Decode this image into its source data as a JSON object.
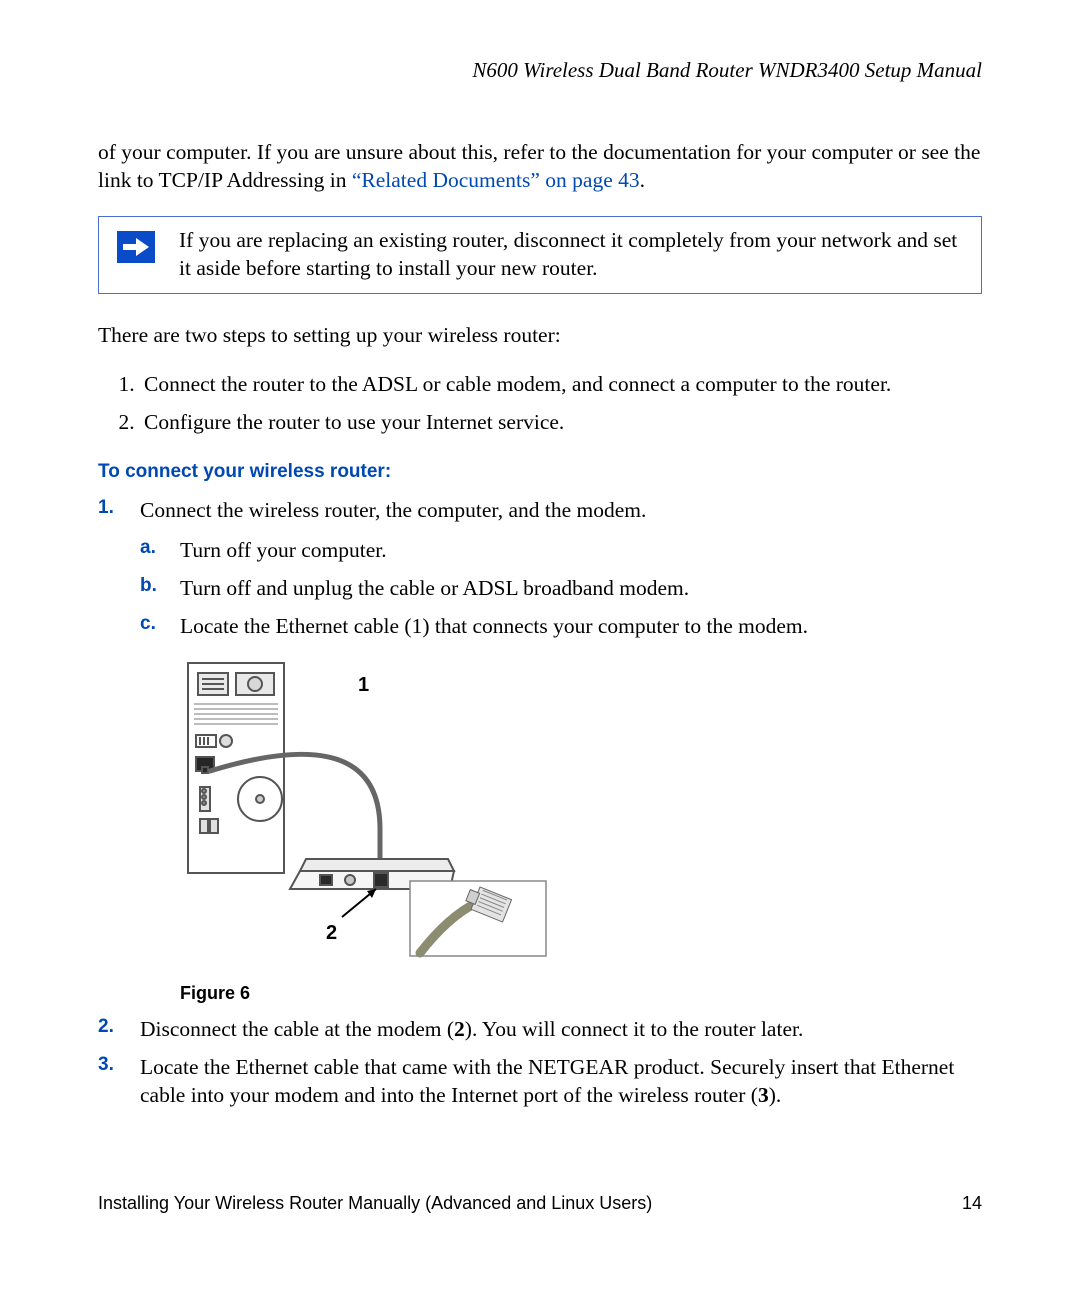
{
  "header": "N600 Wireless Dual Band Router WNDR3400 Setup Manual",
  "intro": {
    "pre_link": "of your computer. If you are unsure about this, refer to the documentation for your computer or see the link to TCP/IP Addressing in ",
    "link": "“Related Documents” on page 43",
    "post_link": "."
  },
  "note": "If you are replacing an existing router, disconnect it completely from your network and set it aside before starting to install your new router.",
  "steps_intro": "There are two steps to setting up your wireless router:",
  "simple_steps": [
    "Connect the router to the ADSL or cable modem, and connect a computer to the router.",
    "Configure the router to use your Internet service."
  ],
  "section_heading": "To connect your wireless router:",
  "blue_steps": {
    "s1": "Connect the wireless router, the computer, and the modem.",
    "s1a": "Turn off your computer.",
    "s1b": "Turn off and unplug the cable or ADSL broadband modem.",
    "s1c": "Locate the Ethernet cable (1) that connects your computer to the modem.",
    "s2_pre": "Disconnect the cable at the modem (",
    "s2_bold": "2",
    "s2_post": "). You will connect it to the router later.",
    "s3_pre": "Locate the Ethernet cable that came with the NETGEAR product. Securely insert that Ethernet cable into your modem and into the Internet port of the wireless router (",
    "s3_bold": "3",
    "s3_post": ")."
  },
  "figure": {
    "caption": "Figure 6",
    "label1": "1",
    "label2": "2"
  },
  "footer": {
    "left": "Installing Your Wireless Router Manually (Advanced and Linux Users)",
    "right": "14"
  }
}
